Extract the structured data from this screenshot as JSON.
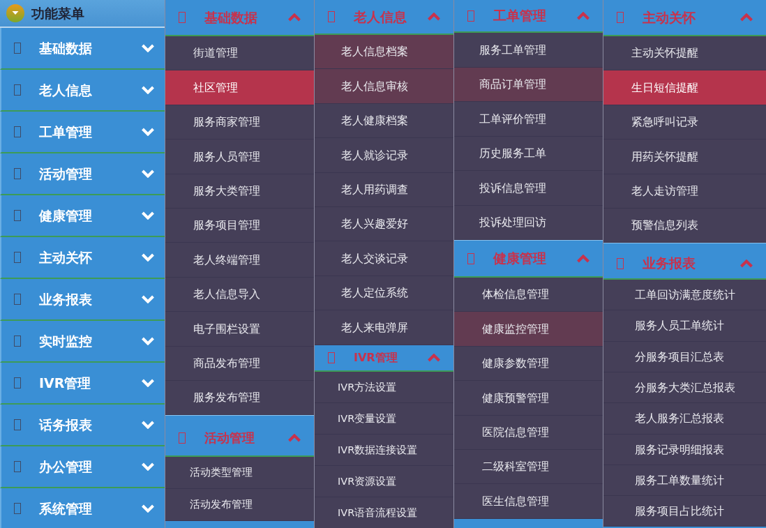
{
  "sidebar": {
    "title": "功能菜单",
    "items": [
      {
        "label": "基础数据",
        "expanded": false
      },
      {
        "label": "老人信息",
        "expanded": false
      },
      {
        "label": "工单管理",
        "expanded": false
      },
      {
        "label": "活动管理",
        "expanded": false
      },
      {
        "label": "健康管理",
        "expanded": false
      },
      {
        "label": "主动关怀",
        "expanded": false
      },
      {
        "label": "业务报表",
        "expanded": false
      },
      {
        "label": "实时监控",
        "expanded": false
      },
      {
        "label": "IVR管理",
        "expanded": false
      },
      {
        "label": "话务报表",
        "expanded": false
      },
      {
        "label": "办公管理",
        "expanded": false
      },
      {
        "label": "系统管理",
        "expanded": false
      }
    ]
  },
  "columns": [
    {
      "panels": [
        {
          "title": "基础数据",
          "expanded": true,
          "items": [
            {
              "label": "街道管理",
              "selected": false,
              "hover": false
            },
            {
              "label": "社区管理",
              "selected": true,
              "hover": false
            },
            {
              "label": "服务商家管理",
              "selected": false,
              "hover": false
            },
            {
              "label": "服务人员管理",
              "selected": false,
              "hover": false
            },
            {
              "label": "服务大类管理",
              "selected": false,
              "hover": false
            },
            {
              "label": "服务项目管理",
              "selected": false,
              "hover": false
            },
            {
              "label": "老人终端管理",
              "selected": false,
              "hover": false
            },
            {
              "label": "老人信息导入",
              "selected": false,
              "hover": false
            },
            {
              "label": "电子围栏设置",
              "selected": false,
              "hover": false
            },
            {
              "label": "商品发布管理",
              "selected": false,
              "hover": false
            },
            {
              "label": "服务发布管理",
              "selected": false,
              "hover": false
            }
          ]
        },
        {
          "title": "活动管理",
          "expanded": true,
          "items": [
            {
              "label": "活动类型管理",
              "selected": false,
              "hover": false
            },
            {
              "label": "活动发布管理",
              "selected": false,
              "hover": false
            }
          ]
        }
      ]
    },
    {
      "panels": [
        {
          "title": "老人信息",
          "expanded": true,
          "items": [
            {
              "label": "老人信息档案",
              "selected": false,
              "hover": true
            },
            {
              "label": "老人信息审核",
              "selected": false,
              "hover": true
            },
            {
              "label": "老人健康档案",
              "selected": false,
              "hover": false
            },
            {
              "label": "老人就诊记录",
              "selected": false,
              "hover": false
            },
            {
              "label": "老人用药调查",
              "selected": false,
              "hover": false
            },
            {
              "label": "老人兴趣爱好",
              "selected": false,
              "hover": false
            },
            {
              "label": "老人交谈记录",
              "selected": false,
              "hover": false
            },
            {
              "label": "老人定位系统",
              "selected": false,
              "hover": false
            },
            {
              "label": "老人来电弹屏",
              "selected": false,
              "hover": false
            }
          ]
        },
        {
          "title": "IVR管理",
          "expanded": true,
          "items": [
            {
              "label": "IVR方法设置",
              "selected": false,
              "hover": false
            },
            {
              "label": "IVR变量设置",
              "selected": false,
              "hover": false
            },
            {
              "label": "IVR数据连接设置",
              "selected": false,
              "hover": false
            },
            {
              "label": "IVR资源设置",
              "selected": false,
              "hover": false
            },
            {
              "label": "IVR语音流程设置",
              "selected": false,
              "hover": false
            }
          ]
        }
      ]
    },
    {
      "panels": [
        {
          "title": "工单管理",
          "expanded": true,
          "items": [
            {
              "label": "服务工单管理",
              "selected": false,
              "hover": false
            },
            {
              "label": "商品订单管理",
              "selected": false,
              "hover": true
            },
            {
              "label": "工单评价管理",
              "selected": false,
              "hover": false
            },
            {
              "label": "历史服务工单",
              "selected": false,
              "hover": false
            },
            {
              "label": "投诉信息管理",
              "selected": false,
              "hover": false
            },
            {
              "label": "投诉处理回访",
              "selected": false,
              "hover": false
            }
          ]
        },
        {
          "title": "健康管理",
          "expanded": true,
          "items": [
            {
              "label": "体检信息管理",
              "selected": false,
              "hover": false
            },
            {
              "label": "健康监控管理",
              "selected": false,
              "hover": true
            },
            {
              "label": "健康参数管理",
              "selected": false,
              "hover": false
            },
            {
              "label": "健康预警管理",
              "selected": false,
              "hover": false
            },
            {
              "label": "医院信息管理",
              "selected": false,
              "hover": false
            },
            {
              "label": "二级科室管理",
              "selected": false,
              "hover": false
            },
            {
              "label": "医生信息管理",
              "selected": false,
              "hover": false
            }
          ]
        }
      ]
    },
    {
      "panels": [
        {
          "title": "主动关怀",
          "expanded": true,
          "items": [
            {
              "label": "主动关怀提醒",
              "selected": false,
              "hover": false
            },
            {
              "label": "生日短信提醒",
              "selected": true,
              "hover": false
            },
            {
              "label": "紧急呼叫记录",
              "selected": false,
              "hover": false
            },
            {
              "label": "用药关怀提醒",
              "selected": false,
              "hover": false
            },
            {
              "label": "老人走访管理",
              "selected": false,
              "hover": false
            },
            {
              "label": "预警信息列表",
              "selected": false,
              "hover": false
            }
          ]
        },
        {
          "title": "业务报表",
          "expanded": true,
          "items": [
            {
              "label": "工单回访满意度统计",
              "selected": false,
              "hover": false
            },
            {
              "label": "服务人员工单统计",
              "selected": false,
              "hover": false
            },
            {
              "label": "分服务项目汇总表",
              "selected": false,
              "hover": false
            },
            {
              "label": "分服务大类汇总报表",
              "selected": false,
              "hover": false
            },
            {
              "label": "老人服务汇总报表",
              "selected": false,
              "hover": false
            },
            {
              "label": "服务记录明细报表",
              "selected": false,
              "hover": false
            },
            {
              "label": "服务工单数量统计",
              "selected": false,
              "hover": false
            },
            {
              "label": "服务项目占比统计",
              "selected": false,
              "hover": false
            }
          ]
        }
      ]
    }
  ]
}
